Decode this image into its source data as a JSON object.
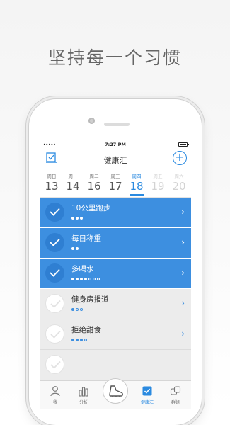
{
  "headline": "坚持每一个习惯",
  "status_bar": {
    "signal": "•••••",
    "time": "7:27 PM",
    "battery": ""
  },
  "nav": {
    "title": "健康汇",
    "add_label": "+"
  },
  "week": [
    {
      "name": "周日",
      "date": "13",
      "state": "past"
    },
    {
      "name": "周一",
      "date": "14",
      "state": "past"
    },
    {
      "name": "周二",
      "date": "16",
      "state": "past"
    },
    {
      "name": "周三",
      "date": "17",
      "state": "past"
    },
    {
      "name": "周四",
      "date": "18",
      "state": "active"
    },
    {
      "name": "周五",
      "date": "19",
      "state": "future"
    },
    {
      "name": "周六",
      "date": "20",
      "state": "future"
    }
  ],
  "habits": [
    {
      "name": "10公里跑步",
      "done": true,
      "progress": 3,
      "total": 3
    },
    {
      "name": "每日称重",
      "done": true,
      "progress": 2,
      "total": 2
    },
    {
      "name": "多喝水",
      "done": true,
      "progress": 4,
      "total": 7
    },
    {
      "name": "健身房报道",
      "done": false,
      "progress": 1,
      "total": 3
    },
    {
      "name": "拒绝甜食",
      "done": false,
      "progress": 3,
      "total": 4
    },
    {
      "name": "",
      "done": false,
      "progress": 0,
      "total": 0
    }
  ],
  "tabs": [
    {
      "label": "我",
      "icon": "person-icon",
      "active": false
    },
    {
      "label": "分析",
      "icon": "bar-chart-icon",
      "active": false
    },
    {
      "label": "",
      "icon": "shoe-icon",
      "active": false
    },
    {
      "label": "健康汇",
      "icon": "checkbox-icon",
      "active": true
    },
    {
      "label": "群组",
      "icon": "group-icon",
      "active": false
    }
  ],
  "colors": {
    "accent": "#2a8ae0",
    "done_row": "#3d8fe0",
    "todo_row": "#ececec"
  }
}
